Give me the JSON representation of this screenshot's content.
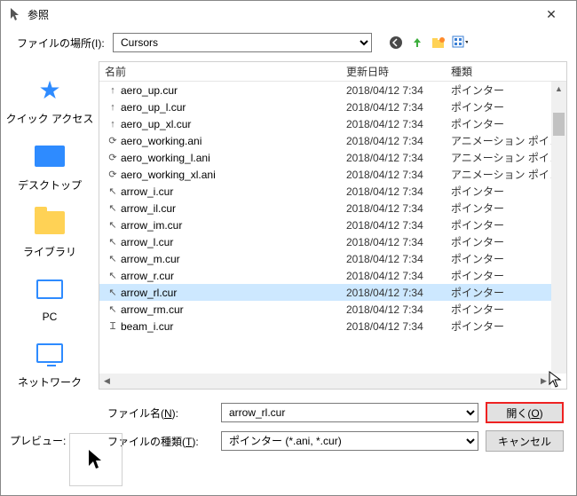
{
  "title": "参照",
  "location_label": "ファイルの場所(I):",
  "location_value": "Cursors",
  "columns": {
    "name": "名前",
    "date": "更新日時",
    "type": "種類"
  },
  "places": {
    "quick": "クイック アクセス",
    "desktop": "デスクトップ",
    "library": "ライブラリ",
    "pc": "PC",
    "network": "ネットワーク"
  },
  "files": [
    {
      "icon": "↑",
      "name": "aero_up.cur",
      "date": "2018/04/12 7:34",
      "type": "ポインター"
    },
    {
      "icon": "↑",
      "name": "aero_up_l.cur",
      "date": "2018/04/12 7:34",
      "type": "ポインター"
    },
    {
      "icon": "↑",
      "name": "aero_up_xl.cur",
      "date": "2018/04/12 7:34",
      "type": "ポインター"
    },
    {
      "icon": "⟳",
      "name": "aero_working.ani",
      "date": "2018/04/12 7:34",
      "type": "アニメーション ポイン"
    },
    {
      "icon": "⟳",
      "name": "aero_working_l.ani",
      "date": "2018/04/12 7:34",
      "type": "アニメーション ポイン"
    },
    {
      "icon": "⟳",
      "name": "aero_working_xl.ani",
      "date": "2018/04/12 7:34",
      "type": "アニメーション ポイン"
    },
    {
      "icon": "↖",
      "name": "arrow_i.cur",
      "date": "2018/04/12 7:34",
      "type": "ポインター"
    },
    {
      "icon": "↖",
      "name": "arrow_il.cur",
      "date": "2018/04/12 7:34",
      "type": "ポインター"
    },
    {
      "icon": "↖",
      "name": "arrow_im.cur",
      "date": "2018/04/12 7:34",
      "type": "ポインター"
    },
    {
      "icon": "↖",
      "name": "arrow_l.cur",
      "date": "2018/04/12 7:34",
      "type": "ポインター"
    },
    {
      "icon": "↖",
      "name": "arrow_m.cur",
      "date": "2018/04/12 7:34",
      "type": "ポインター"
    },
    {
      "icon": "↖",
      "name": "arrow_r.cur",
      "date": "2018/04/12 7:34",
      "type": "ポインター"
    },
    {
      "icon": "↖",
      "name": "arrow_rl.cur",
      "date": "2018/04/12 7:34",
      "type": "ポインター",
      "selected": true
    },
    {
      "icon": "↖",
      "name": "arrow_rm.cur",
      "date": "2018/04/12 7:34",
      "type": "ポインター"
    },
    {
      "icon": "Ɪ",
      "name": "beam_i.cur",
      "date": "2018/04/12 7:34",
      "type": "ポインター"
    }
  ],
  "filename_label_pre": "ファイル名(",
  "filename_label_key": "N",
  "filename_label_post": "):",
  "filename_value": "arrow_rl.cur",
  "filetype_label_pre": "ファイルの種類(",
  "filetype_label_key": "T",
  "filetype_label_post": "):",
  "filetype_value": "ポインター (*.ani, *.cur)",
  "open_pre": "開く(",
  "open_key": "O",
  "open_post": ")",
  "cancel_label": "キャンセル",
  "preview_label": "プレビュー:",
  "preview_glyph": "↖"
}
